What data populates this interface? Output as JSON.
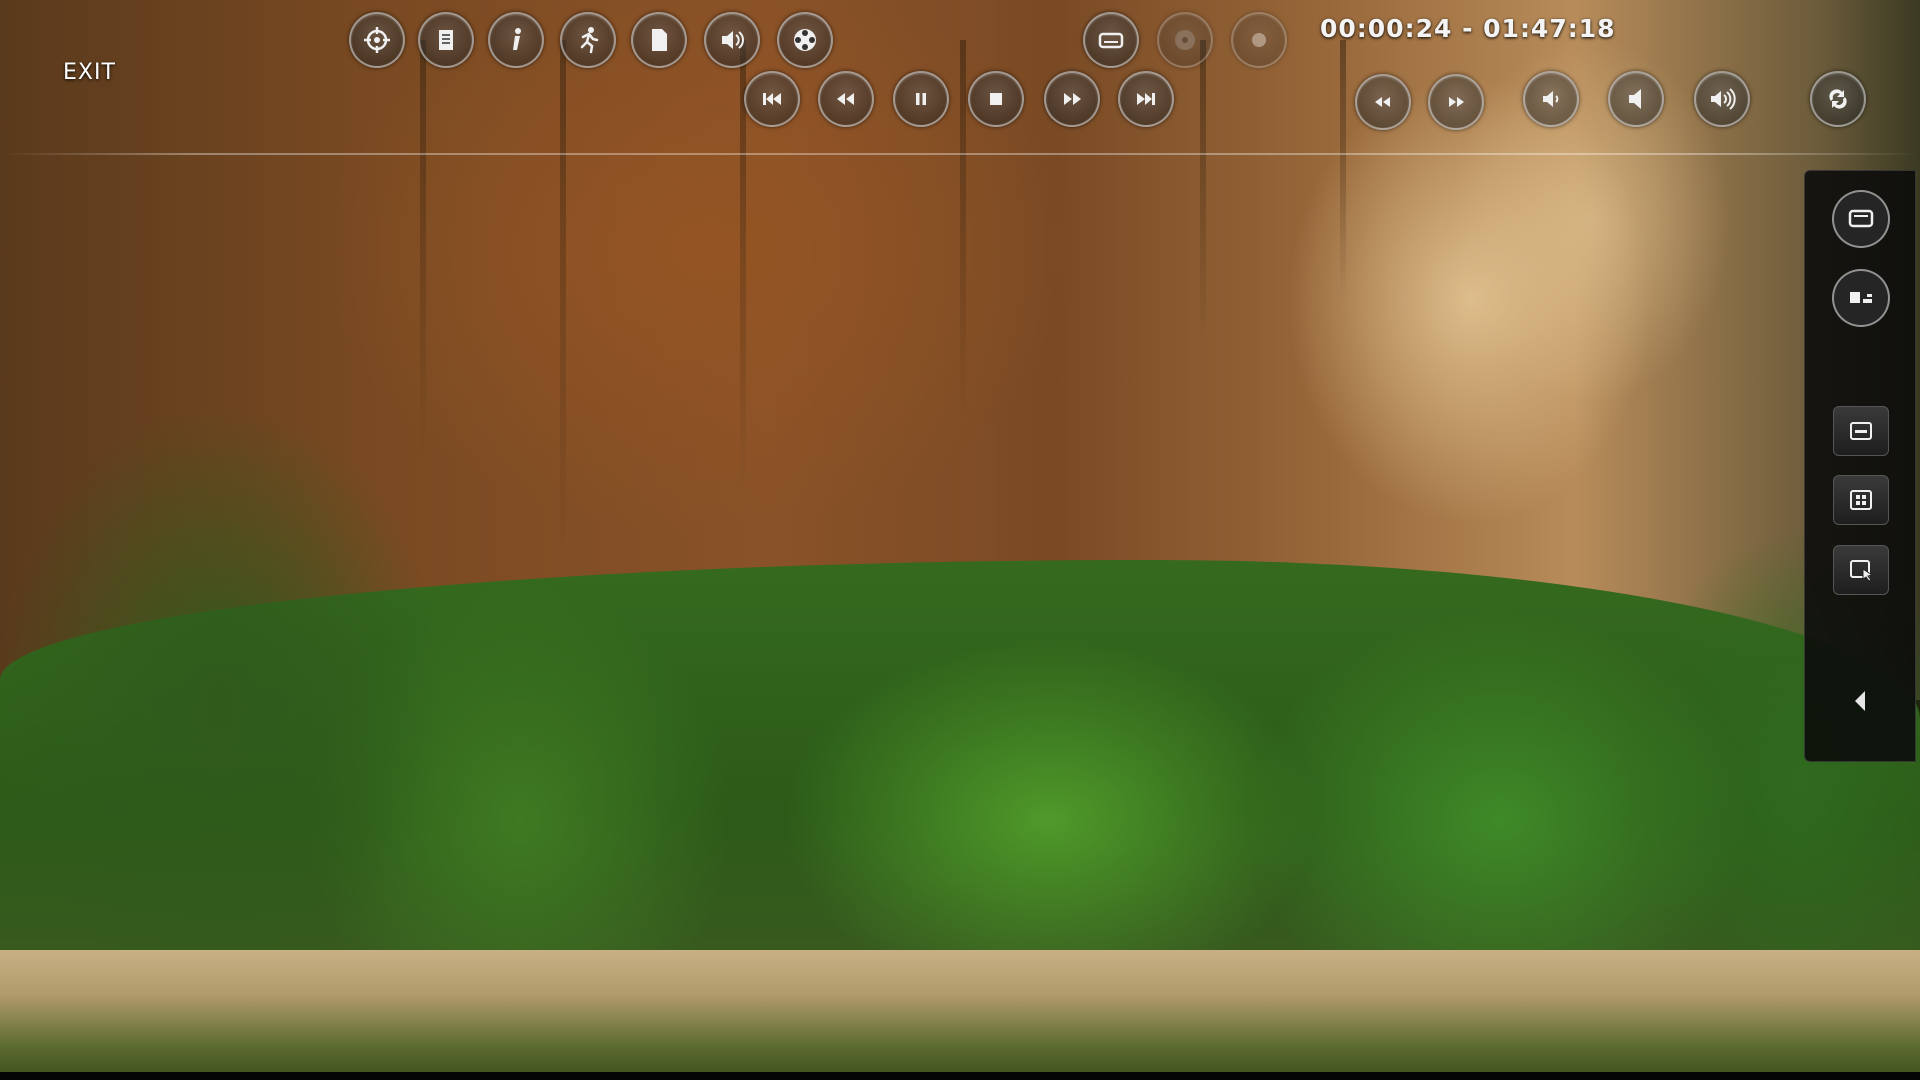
{
  "player": {
    "exit_label": "EXIT",
    "time_display": "00:00:24 - 01:47:18"
  },
  "top_row": [
    {
      "name": "target-button",
      "icon": "crosshair-icon"
    },
    {
      "name": "playlist-button",
      "icon": "document-icon"
    },
    {
      "name": "info-button",
      "icon": "info-icon"
    },
    {
      "name": "effects-button",
      "icon": "running-figure-icon"
    },
    {
      "name": "file-button",
      "icon": "file-icon"
    },
    {
      "name": "audio-button",
      "icon": "speaker-icon"
    },
    {
      "name": "film-reel-button",
      "icon": "film-reel-icon"
    },
    {
      "name": "aspect-ratio-button",
      "icon": "screen-icon"
    },
    {
      "name": "disc-button",
      "icon": "disc-icon"
    },
    {
      "name": "record-button",
      "icon": "record-icon"
    }
  ],
  "transport": [
    {
      "name": "skip-previous-button",
      "icon": "skip-previous-icon"
    },
    {
      "name": "rewind-button",
      "icon": "rewind-icon"
    },
    {
      "name": "pause-button",
      "icon": "pause-icon"
    },
    {
      "name": "stop-button",
      "icon": "stop-icon"
    },
    {
      "name": "fast-forward-button",
      "icon": "fast-forward-icon"
    },
    {
      "name": "skip-next-button",
      "icon": "skip-next-icon"
    },
    {
      "name": "step-back-button",
      "icon": "step-back-icon"
    },
    {
      "name": "step-forward-button",
      "icon": "step-forward-icon"
    },
    {
      "name": "volume-down-button",
      "icon": "volume-down-icon"
    },
    {
      "name": "mute-button",
      "icon": "mute-icon"
    },
    {
      "name": "volume-up-button",
      "icon": "volume-up-icon"
    },
    {
      "name": "repeat-button",
      "icon": "repeat-icon"
    }
  ],
  "side_panel": [
    {
      "name": "fullscreen-button",
      "icon": "screen-icon"
    },
    {
      "name": "picture-in-picture-button",
      "icon": "pip-icon"
    },
    {
      "name": "minimize-button",
      "icon": "minimize-icon"
    },
    {
      "name": "grid-button",
      "icon": "grid-icon"
    },
    {
      "name": "pointer-button",
      "icon": "cursor-icon"
    },
    {
      "name": "collapse-panel-button",
      "icon": "chevron-left-icon"
    }
  ]
}
